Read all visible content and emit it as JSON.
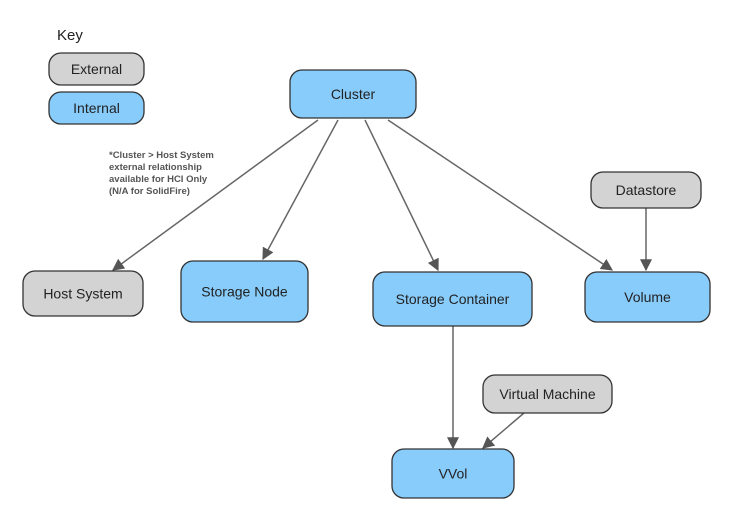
{
  "colors": {
    "external": "#d3d3d3",
    "internal": "#88ccfc",
    "stroke": "#333333",
    "edge": "#666666"
  },
  "key": {
    "title": "Key",
    "items": [
      {
        "id": "key-external",
        "label": "External",
        "kind": "external"
      },
      {
        "id": "key-internal",
        "label": "Internal",
        "kind": "internal"
      }
    ]
  },
  "note": {
    "lines": [
      "*Cluster > Host System",
      "external relationship",
      "available for HCI Only",
      "(N/A for SolidFire)"
    ]
  },
  "nodes": [
    {
      "id": "cluster",
      "label": "Cluster",
      "kind": "internal"
    },
    {
      "id": "host-system",
      "label": "Host System",
      "kind": "external"
    },
    {
      "id": "storage-node",
      "label": "Storage Node",
      "kind": "internal"
    },
    {
      "id": "storage-container",
      "label": "Storage Container",
      "kind": "internal"
    },
    {
      "id": "volume",
      "label": "Volume",
      "kind": "internal"
    },
    {
      "id": "datastore",
      "label": "Datastore",
      "kind": "external"
    },
    {
      "id": "virtual-machine",
      "label": "Virtual Machine",
      "kind": "external"
    },
    {
      "id": "vvol",
      "label": "VVol",
      "kind": "internal"
    }
  ],
  "edges": [
    {
      "from": "cluster",
      "to": "host-system"
    },
    {
      "from": "cluster",
      "to": "storage-node"
    },
    {
      "from": "cluster",
      "to": "storage-container"
    },
    {
      "from": "cluster",
      "to": "volume"
    },
    {
      "from": "datastore",
      "to": "volume"
    },
    {
      "from": "storage-container",
      "to": "vvol"
    },
    {
      "from": "virtual-machine",
      "to": "vvol"
    }
  ]
}
